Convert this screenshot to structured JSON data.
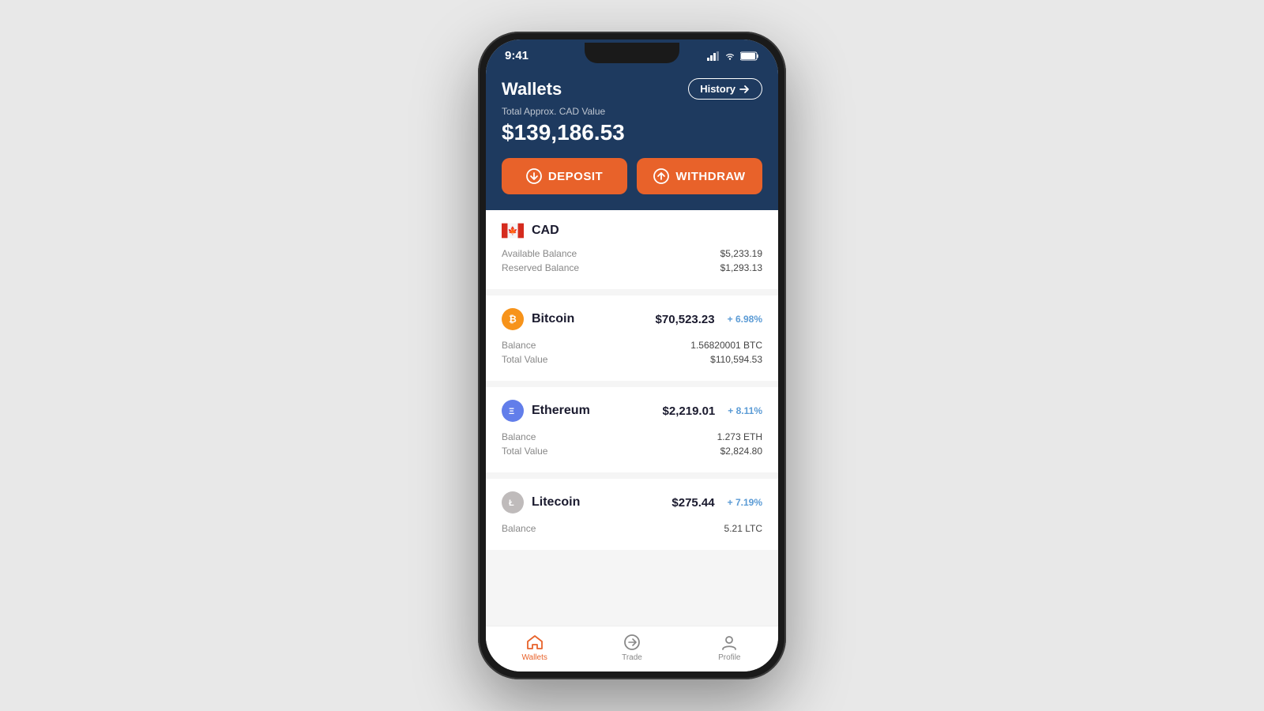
{
  "phone": {
    "status_time": "9:41",
    "notch": true
  },
  "header": {
    "title": "Wallets",
    "history_label": "History",
    "total_label": "Total Approx. CAD Value",
    "total_value": "$139,186.53"
  },
  "actions": {
    "deposit_label": "Deposit",
    "withdraw_label": "Withdraw"
  },
  "wallets": [
    {
      "id": "cad",
      "name": "CAD",
      "icon_type": "flag",
      "rows": [
        {
          "label": "Available Balance",
          "value": "$5,233.19"
        },
        {
          "label": "Reserved Balance",
          "value": "$1,293.13"
        }
      ]
    },
    {
      "id": "btc",
      "name": "Bitcoin",
      "icon_type": "btc",
      "price": "$70,523.23",
      "change": "+ 6.98%",
      "rows": [
        {
          "label": "Balance",
          "value": "1.56820001 BTC"
        },
        {
          "label": "Total Value",
          "value": "$110,594.53"
        }
      ]
    },
    {
      "id": "eth",
      "name": "Ethereum",
      "icon_type": "eth",
      "price": "$2,219.01",
      "change": "+ 8.11%",
      "rows": [
        {
          "label": "Balance",
          "value": "1.273 ETH"
        },
        {
          "label": "Total Value",
          "value": "$2,824.80"
        }
      ]
    },
    {
      "id": "ltc",
      "name": "Litecoin",
      "icon_type": "ltc",
      "price": "$275.44",
      "change": "+ 7.19%",
      "rows": [
        {
          "label": "Balance",
          "value": "5.21 LTC"
        }
      ]
    }
  ],
  "nav": {
    "items": [
      {
        "id": "wallets",
        "label": "Wallets",
        "active": true
      },
      {
        "id": "trade",
        "label": "Trade",
        "active": false
      },
      {
        "id": "profile",
        "label": "Profile",
        "active": false
      }
    ]
  }
}
